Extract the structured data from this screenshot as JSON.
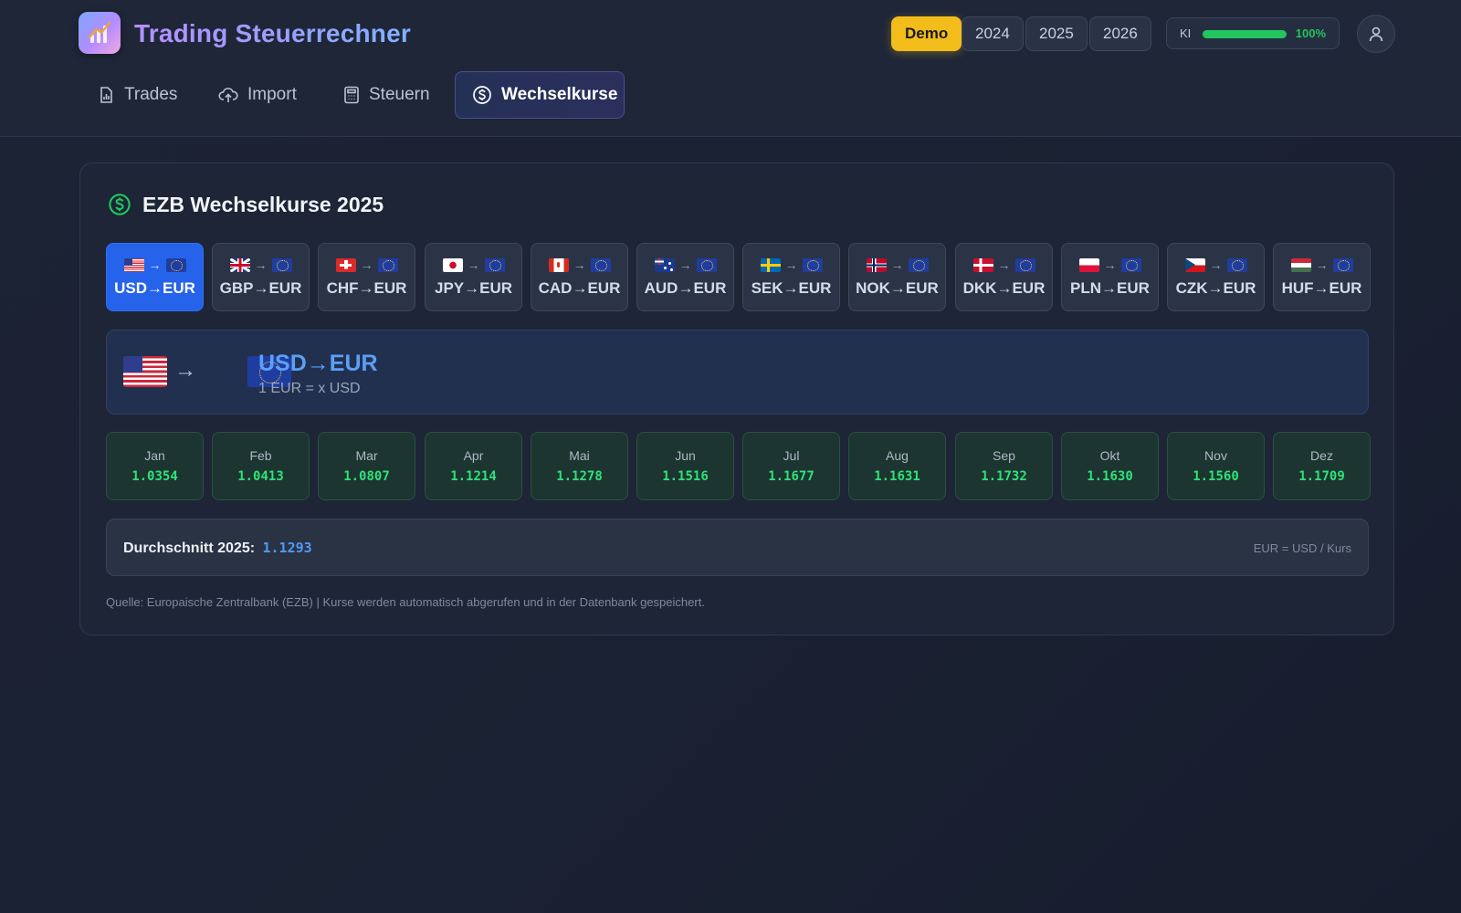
{
  "header": {
    "app_title": "Trading Steuerrechner",
    "mode_label": "Demo",
    "years": [
      "2024",
      "2025",
      "2026"
    ],
    "ki": {
      "label": "KI",
      "percent_text": "100%",
      "level": 1.0
    },
    "logo_icon": "trending-chart-logo",
    "user_icon": "user-icon"
  },
  "nav": {
    "tabs": [
      {
        "label": "Trades",
        "icon": "bar-chart-file-icon",
        "active": false
      },
      {
        "label": "Import",
        "icon": "cloud-upload-icon",
        "active": false
      },
      {
        "label": "Steuern",
        "icon": "calculator-icon",
        "active": false
      },
      {
        "label": "Wechselkurse",
        "icon": "dollar-circle-icon",
        "active": true
      }
    ]
  },
  "card": {
    "title": "EZB Wechselkurse 2025",
    "title_icon": "dollar-circle-icon",
    "pairs": [
      {
        "label": "USD→EUR",
        "flag": "us",
        "active": true
      },
      {
        "label": "GBP→EUR",
        "flag": "gb",
        "active": false
      },
      {
        "label": "CHF→EUR",
        "flag": "ch",
        "active": false
      },
      {
        "label": "JPY→EUR",
        "flag": "jp",
        "active": false
      },
      {
        "label": "CAD→EUR",
        "flag": "ca",
        "active": false
      },
      {
        "label": "AUD→EUR",
        "flag": "au",
        "active": false
      },
      {
        "label": "SEK→EUR",
        "flag": "se",
        "active": false
      },
      {
        "label": "NOK→EUR",
        "flag": "no",
        "active": false
      },
      {
        "label": "DKK→EUR",
        "flag": "dk",
        "active": false
      },
      {
        "label": "PLN→EUR",
        "flag": "pl",
        "active": false
      },
      {
        "label": "CZK→EUR",
        "flag": "cz",
        "active": false
      },
      {
        "label": "HUF→EUR",
        "flag": "hu",
        "active": false
      }
    ],
    "selected": {
      "pair": "USD→EUR",
      "description": "1 EUR = x USD",
      "from_flag": "us",
      "to_flag": "eu",
      "arrow": "→"
    },
    "months": [
      {
        "name": "Jan",
        "rate": "1.0354"
      },
      {
        "name": "Feb",
        "rate": "1.0413"
      },
      {
        "name": "Mar",
        "rate": "1.0807"
      },
      {
        "name": "Apr",
        "rate": "1.1214"
      },
      {
        "name": "Mai",
        "rate": "1.1278"
      },
      {
        "name": "Jun",
        "rate": "1.1516"
      },
      {
        "name": "Jul",
        "rate": "1.1677"
      },
      {
        "name": "Aug",
        "rate": "1.1631"
      },
      {
        "name": "Sep",
        "rate": "1.1732"
      },
      {
        "name": "Okt",
        "rate": "1.1630"
      },
      {
        "name": "Nov",
        "rate": "1.1560"
      },
      {
        "name": "Dez",
        "rate": "1.1709"
      }
    ],
    "average": {
      "label": "Durchschnitt 2025:",
      "value": "1.1293",
      "formula": "EUR = USD / Kurs"
    },
    "source_note": "Quelle: Europaische Zentralbank (EZB) | Kurse werden automatisch abgerufen und in der Datenbank gespeichert."
  },
  "colors": {
    "accent_blue": "#2563eb",
    "demo_yellow": "#f2bd1a",
    "rate_green": "#2ee27a",
    "ki_green": "#22c55e"
  }
}
